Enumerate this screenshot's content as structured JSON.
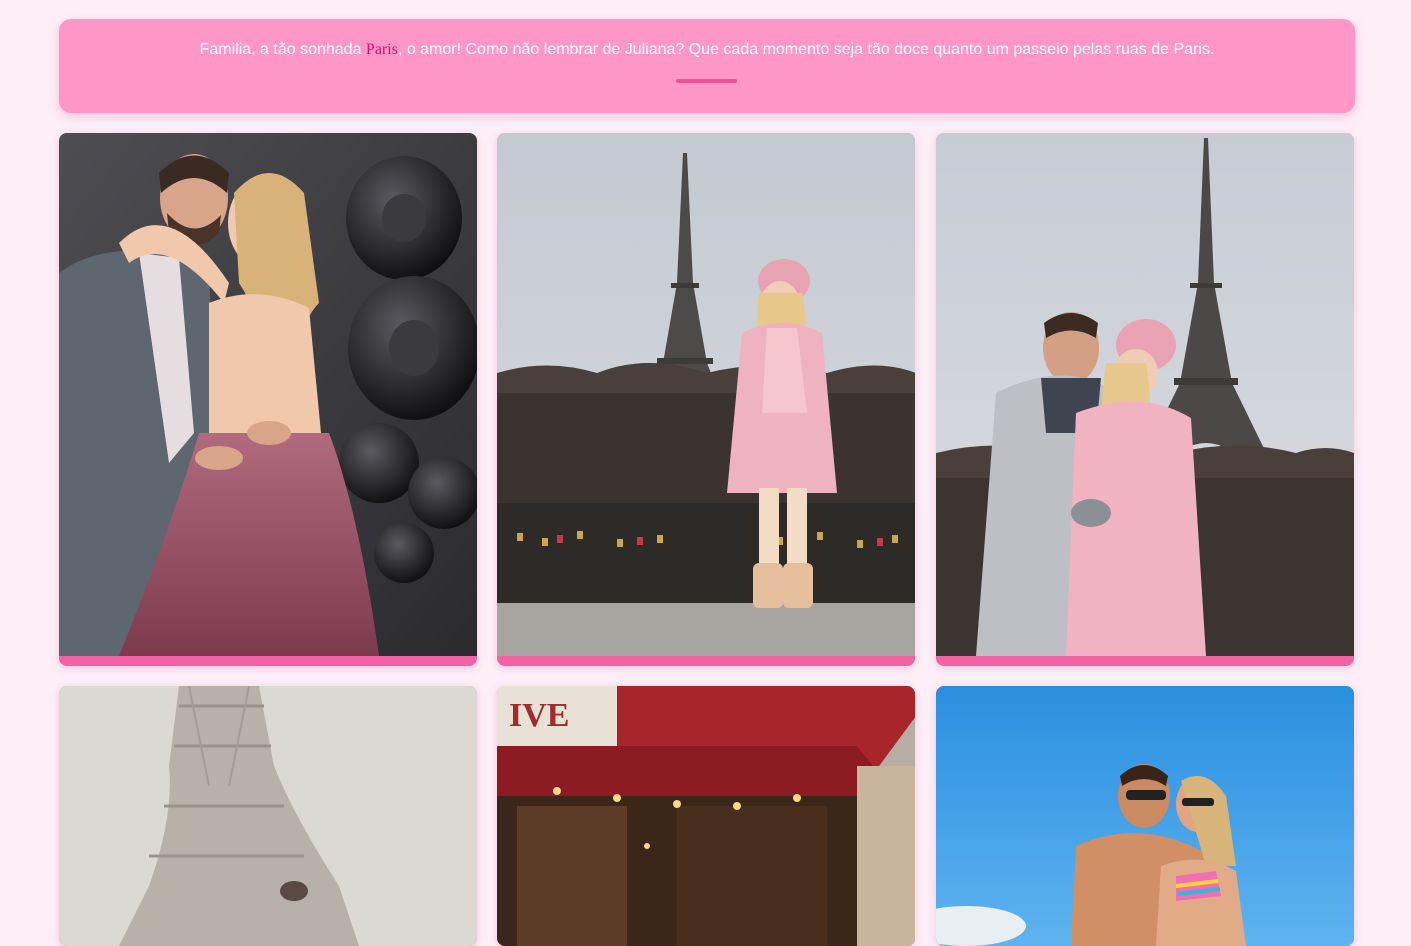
{
  "banner": {
    "text_before": "Familia, a tão sonhada ",
    "highlight": "Paris",
    "text_after": ", o amor! Como não lembrar de Juliana? Que cada momento seja tão doce quanto um passeio pelas ruas de Paris.",
    "accent_color": "#ee4f95",
    "background_color": "#ff96c8"
  },
  "gallery": {
    "photos": [
      {
        "subject": "couple-embrace-balloon-8"
      },
      {
        "subject": "woman-pink-coat-eiffel-tower"
      },
      {
        "subject": "couple-kiss-eiffel-tower"
      },
      {
        "subject": "eiffel-tower-closeup"
      },
      {
        "subject": "paris-cafe-storefront"
      },
      {
        "subject": "couple-beach-sky"
      }
    ],
    "card_accent": "#f262a4"
  }
}
